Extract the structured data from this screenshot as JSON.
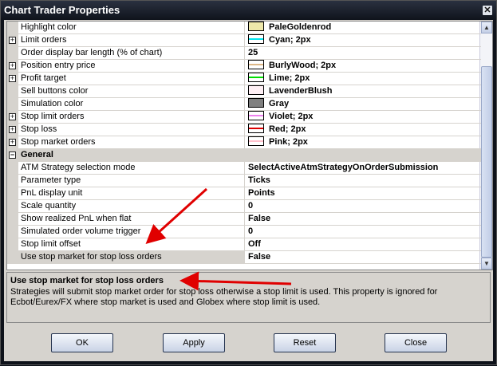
{
  "window": {
    "title": "Chart Trader Properties",
    "close": "✕"
  },
  "rows": [
    {
      "name": "Highlight color",
      "value": "PaleGoldenrod",
      "expand": false,
      "swatch": "#eee8aa",
      "line": null
    },
    {
      "name": "Limit orders",
      "value": "Cyan; 2px",
      "expand": true,
      "swatch": "#fff",
      "line": "#00e5ee"
    },
    {
      "name": "Order display bar length (% of chart)",
      "value": "25",
      "expand": false,
      "swatch": null,
      "line": null
    },
    {
      "name": "Position entry price",
      "value": "BurlyWood; 2px",
      "expand": true,
      "swatch": "#fff",
      "line": "#deb887"
    },
    {
      "name": "Profit target",
      "value": "Lime; 2px",
      "expand": true,
      "swatch": "#fff",
      "line": "#00dd00"
    },
    {
      "name": "Sell buttons color",
      "value": "LavenderBlush",
      "expand": false,
      "swatch": "#fff0f5",
      "line": null
    },
    {
      "name": "Simulation color",
      "value": "Gray",
      "expand": false,
      "swatch": "#808080",
      "line": null
    },
    {
      "name": "Stop limit orders",
      "value": "Violet; 2px",
      "expand": true,
      "swatch": "#fff",
      "line": "#ee82ee"
    },
    {
      "name": "Stop loss",
      "value": "Red; 2px",
      "expand": true,
      "swatch": "#fff",
      "line": "#dd0000"
    },
    {
      "name": "Stop market orders",
      "value": "Pink; 2px",
      "expand": true,
      "swatch": "#fff",
      "line": "#ffc0cb"
    }
  ],
  "category": {
    "label": "General",
    "symbol": "−"
  },
  "general_rows": [
    {
      "name": "ATM Strategy selection mode",
      "value": "SelectActiveAtmStrategyOnOrderSubmission"
    },
    {
      "name": "Parameter type",
      "value": "Ticks"
    },
    {
      "name": "PnL display unit",
      "value": "Points"
    },
    {
      "name": "Scale quantity",
      "value": "0"
    },
    {
      "name": "Show realized PnL when flat",
      "value": "False"
    },
    {
      "name": "Simulated order volume trigger",
      "value": "0"
    },
    {
      "name": "Stop limit offset",
      "value": "Off"
    },
    {
      "name": "Use stop market for stop loss orders",
      "value": "False"
    }
  ],
  "description": {
    "title": "Use stop market for stop loss orders",
    "text": "Strategies will submit stop market order for stop loss otherwise a stop limit is used. This property is ignored for Ecbot/Eurex/FX where stop market is used and Globex where stop limit is used."
  },
  "buttons": {
    "ok": "OK",
    "apply": "Apply",
    "reset": "Reset",
    "close": "Close"
  },
  "scroll": {
    "up": "▲",
    "down": "▼"
  },
  "annotation_color": "#e00000"
}
